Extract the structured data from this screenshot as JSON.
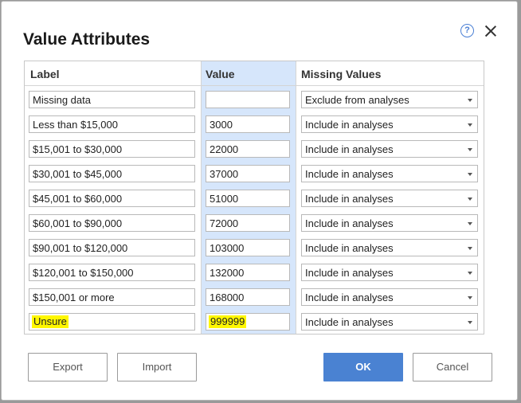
{
  "dialog": {
    "title": "Value Attributes",
    "help_glyph": "?"
  },
  "columns": {
    "label": "Label",
    "value": "Value",
    "missing": "Missing Values"
  },
  "rows": [
    {
      "label": "Missing data",
      "value": "",
      "missing": "Exclude from analyses",
      "highlighted": false
    },
    {
      "label": "Less than $15,000",
      "value": "3000",
      "missing": "Include in analyses",
      "highlighted": false
    },
    {
      "label": "$15,001 to $30,000",
      "value": "22000",
      "missing": "Include in analyses",
      "highlighted": false
    },
    {
      "label": "$30,001 to $45,000",
      "value": "37000",
      "missing": "Include in analyses",
      "highlighted": false
    },
    {
      "label": "$45,001 to $60,000",
      "value": "51000",
      "missing": "Include in analyses",
      "highlighted": false
    },
    {
      "label": "$60,001 to $90,000",
      "value": "72000",
      "missing": "Include in analyses",
      "highlighted": false
    },
    {
      "label": "$90,001 to $120,000",
      "value": "103000",
      "missing": "Include in analyses",
      "highlighted": false
    },
    {
      "label": "$120,001 to $150,000",
      "value": "132000",
      "missing": "Include in analyses",
      "highlighted": false
    },
    {
      "label": "$150,001 or more",
      "value": "168000",
      "missing": "Include in analyses",
      "highlighted": false
    },
    {
      "label": "Unsure",
      "value": "999999",
      "missing": "Include in analyses",
      "highlighted": true
    }
  ],
  "buttons": {
    "export": "Export",
    "import": "Import",
    "ok": "OK",
    "cancel": "Cancel"
  },
  "colors": {
    "primary": "#4a82d2",
    "value_column": "#d6e6fb",
    "highlight": "#fff700"
  }
}
